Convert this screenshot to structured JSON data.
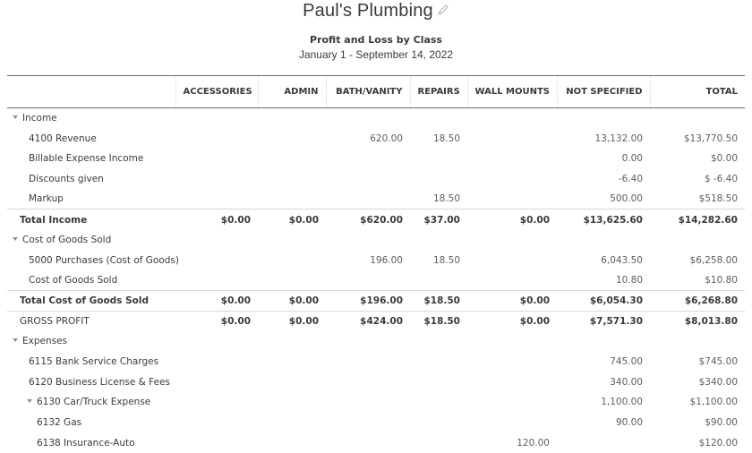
{
  "header": {
    "company_name": "Paul's Plumbing",
    "edit_icon": "pencil-icon",
    "report_title": "Profit and Loss by Class",
    "date_range": "January 1 - September 14, 2022"
  },
  "columns": [
    "",
    "ACCESSORIES",
    "ADMIN",
    "BATH/VANITY",
    "REPAIRS",
    "WALL MOUNTS",
    "NOT SPECIFIED",
    "TOTAL"
  ],
  "rows": [
    {
      "type": "group",
      "label": "Income",
      "values": [
        "",
        "",
        "",
        "",
        "",
        "",
        ""
      ]
    },
    {
      "type": "line",
      "label": "4100 Revenue",
      "values": [
        "",
        "",
        "620.00",
        "18.50",
        "",
        "13,132.00",
        "$13,770.50"
      ]
    },
    {
      "type": "line",
      "label": "Billable Expense Income",
      "values": [
        "",
        "",
        "",
        "",
        "",
        "0.00",
        "$0.00"
      ]
    },
    {
      "type": "line",
      "label": "Discounts given",
      "values": [
        "",
        "",
        "",
        "",
        "",
        "-6.40",
        "$ -6.40"
      ]
    },
    {
      "type": "line",
      "label": "Markup",
      "values": [
        "",
        "",
        "",
        "18.50",
        "",
        "500.00",
        "$518.50"
      ]
    },
    {
      "type": "total",
      "label": "Total Income",
      "values": [
        "$0.00",
        "$0.00",
        "$620.00",
        "$37.00",
        "$0.00",
        "$13,625.60",
        "$14,282.60"
      ]
    },
    {
      "type": "group",
      "label": "Cost of Goods Sold",
      "values": [
        "",
        "",
        "",
        "",
        "",
        "",
        ""
      ]
    },
    {
      "type": "line",
      "label": "5000 Purchases (Cost of Goods)",
      "values": [
        "",
        "",
        "196.00",
        "18.50",
        "",
        "6,043.50",
        "$6,258.00"
      ]
    },
    {
      "type": "line",
      "label": "Cost of Goods Sold",
      "values": [
        "",
        "",
        "",
        "",
        "",
        "10.80",
        "$10.80"
      ]
    },
    {
      "type": "total",
      "label": "Total Cost of Goods Sold",
      "values": [
        "$0.00",
        "$0.00",
        "$196.00",
        "$18.50",
        "$0.00",
        "$6,054.30",
        "$6,268.80"
      ]
    },
    {
      "type": "gross",
      "label": "GROSS PROFIT",
      "values": [
        "$0.00",
        "$0.00",
        "$424.00",
        "$18.50",
        "$0.00",
        "$7,571.30",
        "$8,013.80"
      ]
    },
    {
      "type": "group",
      "label": "Expenses",
      "values": [
        "",
        "",
        "",
        "",
        "",
        "",
        ""
      ]
    },
    {
      "type": "line",
      "label": "6115 Bank Service Charges",
      "values": [
        "",
        "",
        "",
        "",
        "",
        "745.00",
        "$745.00"
      ]
    },
    {
      "type": "line",
      "label": "6120 Business License & Fees",
      "values": [
        "",
        "",
        "",
        "",
        "",
        "340.00",
        "$340.00"
      ]
    },
    {
      "type": "subgroup",
      "label": "6130 Car/Truck Expense",
      "values": [
        "",
        "",
        "",
        "",
        "",
        "1,100.00",
        "$1,100.00"
      ]
    },
    {
      "type": "subline",
      "label": "6132 Gas",
      "values": [
        "",
        "",
        "",
        "",
        "",
        "90.00",
        "$90.00"
      ]
    },
    {
      "type": "subline",
      "label": "6138 Insurance-Auto",
      "values": [
        "",
        "",
        "",
        "",
        "120.00",
        "",
        "$120.00"
      ]
    }
  ]
}
